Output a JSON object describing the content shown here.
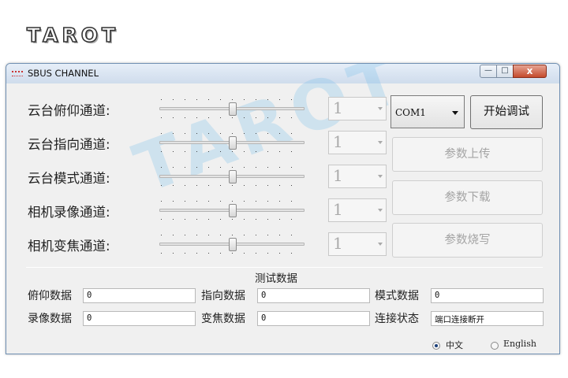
{
  "brand": {
    "logo": "TAROT",
    "watermark": "TAROT"
  },
  "window": {
    "title": "SBUS CHANNEL",
    "minimize": "—",
    "maximize": "□",
    "close": "x"
  },
  "channels": [
    {
      "label": "云台俯仰通道:",
      "value": "1"
    },
    {
      "label": "云台指向通道:",
      "value": "1"
    },
    {
      "label": "云台模式通道:",
      "value": "1"
    },
    {
      "label": "相机录像通道:",
      "value": "1"
    },
    {
      "label": "相机变焦通道:",
      "value": "1"
    }
  ],
  "port": {
    "value": "COM1"
  },
  "buttons": {
    "start_debug": "开始调试",
    "upload": "参数上传",
    "download": "参数下载",
    "flash": "参数烧写"
  },
  "test": {
    "title": "测试数据",
    "fields": [
      {
        "label": "俯仰数据",
        "value": "0"
      },
      {
        "label": "指向数据",
        "value": "0"
      },
      {
        "label": "模式数据",
        "value": "0"
      },
      {
        "label": "录像数据",
        "value": "0"
      },
      {
        "label": "变焦数据",
        "value": "0"
      },
      {
        "label": "连接状态",
        "value": "端口连接断开"
      }
    ]
  },
  "language": {
    "chinese": "中文",
    "english": "English",
    "selected": "中文"
  }
}
